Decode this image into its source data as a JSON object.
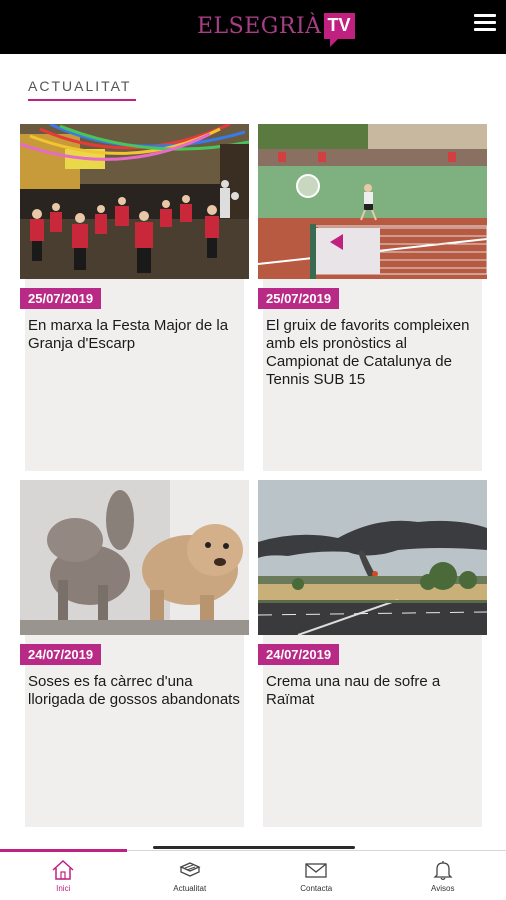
{
  "header": {
    "logo_text": "ELSEGRIÀ",
    "logo_tv": "TV",
    "menu_icon": "hamburger-menu-icon"
  },
  "section": {
    "title": "ACTUALITAT"
  },
  "articles": [
    {
      "date": "25/07/2019",
      "title": "En marxa la Festa Major de la Granja d'Escarp"
    },
    {
      "date": "25/07/2019",
      "title": "El gruix de favorits compleixen amb els pronòstics al Campionat de Catalunya de Tennis SUB 15"
    },
    {
      "date": "24/07/2019",
      "title": "Soses es fa càrrec d'una llorigada de gossos abandonats"
    },
    {
      "date": "24/07/2019",
      "title": "Crema una nau de sofre a Raïmat"
    }
  ],
  "bottom_nav": [
    {
      "label": "Inici",
      "icon": "home-icon",
      "active": true
    },
    {
      "label": "Actualitat",
      "icon": "newspaper-icon",
      "active": false
    },
    {
      "label": "Contacta",
      "icon": "envelope-icon",
      "active": false
    },
    {
      "label": "Avisos",
      "icon": "bell-icon",
      "active": false
    }
  ],
  "colors": {
    "accent": "#c0207f",
    "badge": "#b82a86",
    "card_bg": "#f0efed",
    "header_bg": "#000000"
  }
}
